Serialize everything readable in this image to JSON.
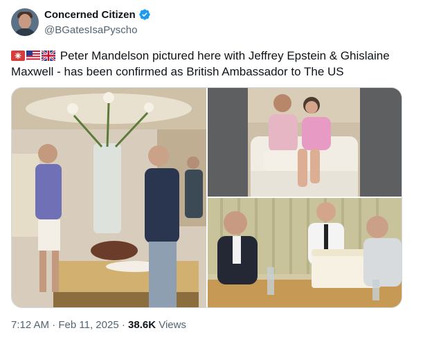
{
  "author": {
    "display_name": "Concerned Citizen",
    "handle": "@BGatesIsaPyscho",
    "verified": true,
    "verified_color": "#1d9bf0",
    "avatar_icon": "profile-photo"
  },
  "tweet": {
    "flags": [
      "red-square-flag-icon",
      "us-flag-icon",
      "uk-flag-icon"
    ],
    "text": "Peter Mandelson pictured here with Jeffrey Epstein & Ghislaine Maxwell - has been confirmed as British Ambassador to The US"
  },
  "media": {
    "photos": [
      "photo-living-room-standing",
      "photo-sofa-couple",
      "photo-birthday-cake-table"
    ]
  },
  "meta": {
    "time": "7:12 AM",
    "separator1": "·",
    "date": "Feb 11, 2025",
    "separator2": "·",
    "views_count": "38.6K",
    "views_label": "Views"
  }
}
